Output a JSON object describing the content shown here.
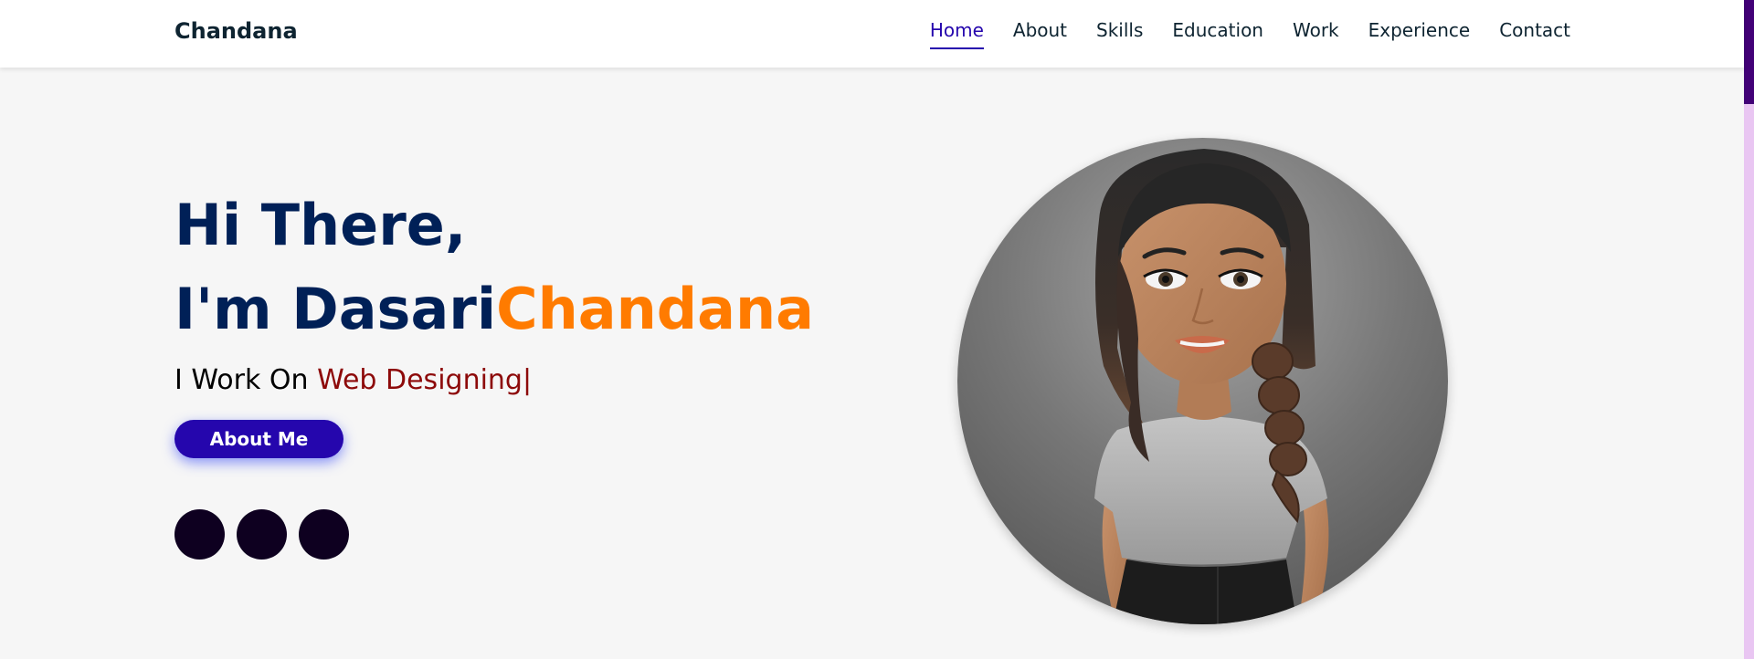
{
  "header": {
    "brand": "Chandana",
    "nav": [
      "Home",
      "About",
      "Skills",
      "Education",
      "Work",
      "Experience",
      "Contact"
    ],
    "active": "Home"
  },
  "hero": {
    "greeting": "Hi There,",
    "name_prefix": "I'm Dasari",
    "name_highlight": "Chandana",
    "work_prefix": "I Work On ",
    "work_typed": "Web Designing",
    "cursor": "|",
    "button_label": "About Me",
    "social_icons": [
      "social-icon",
      "social-icon",
      "social-icon"
    ]
  },
  "colors": {
    "accent": "#2506ad",
    "name_highlight": "#ff7b00",
    "heading": "#002057",
    "typed_text": "#8d0a0a",
    "scrollbar_track": "#e9c6f2",
    "scrollbar_thumb": "#420177"
  }
}
